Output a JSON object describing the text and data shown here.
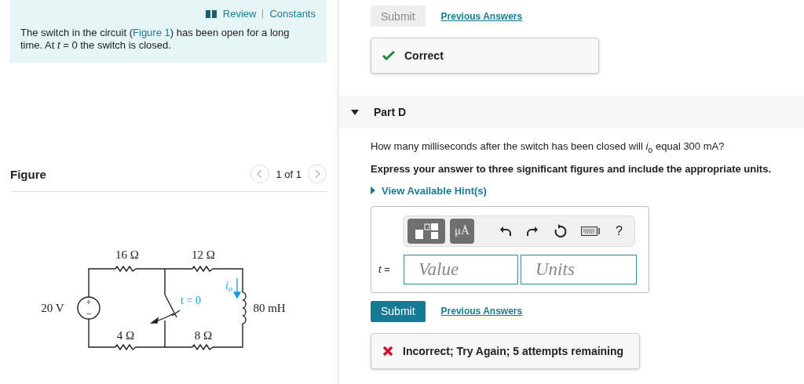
{
  "intro": {
    "links": [
      {
        "label": "Review"
      },
      {
        "label": "Constants"
      }
    ],
    "text_before": "The switch in the circuit (",
    "figure_link": "Figure 1",
    "text_after": ") has been open for a long time. At *t* = 0 the switch is closed."
  },
  "figure": {
    "title": "Figure",
    "pager": "1 of 1",
    "labels": {
      "r1": "16 Ω",
      "r2": "12 Ω",
      "source": "20 V",
      "plus": "+",
      "minus": "−",
      "switch": "t = 0",
      "current": "i",
      "current_sub": "o",
      "inductor": "80 mH",
      "r3": "4 Ω",
      "r4": "8 Ω"
    }
  },
  "previous_part": {
    "submit": {
      "label": "Submit",
      "disabled": true
    },
    "previous_answers": "Previous Answers",
    "feedback": {
      "kind": "correct",
      "text": "Correct"
    }
  },
  "part": {
    "title": "Part D",
    "expanded": true,
    "question": "How many milliseconds after the switch has been closed will *i*$_{o}$ equal 300 mA?",
    "instruction": "Express your answer to three significant figures and include the appropriate units.",
    "hint_link": "View Available Hint(s)",
    "answer": {
      "variable": "*t* =",
      "units_button": "μÅ",
      "help": "?",
      "value_placeholder": "Value",
      "units_placeholder": "Units"
    },
    "submit": {
      "label": "Submit",
      "disabled": false
    },
    "previous_answers": "Previous Answers",
    "feedback": {
      "kind": "incorrect",
      "text": "Incorrect; Try Again; 5 attempts remaining"
    }
  }
}
